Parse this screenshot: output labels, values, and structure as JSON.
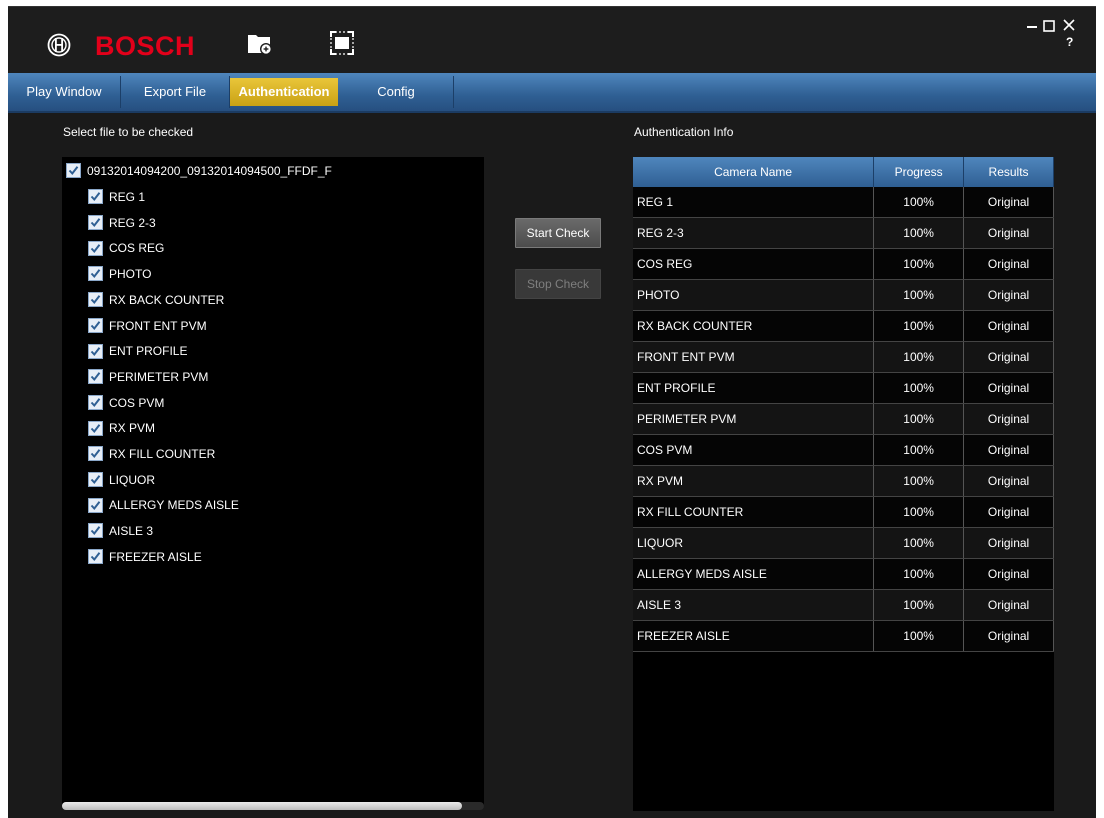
{
  "app": {
    "brand": "BOSCH",
    "brand_color": "#e2001a",
    "window_controls": {
      "minimize": "–",
      "maximize": "□",
      "close": "×",
      "help": "?"
    }
  },
  "menu": {
    "tabs": [
      {
        "label": "Play Window"
      },
      {
        "label": "Export File"
      },
      {
        "label": "Authentication",
        "active": true
      },
      {
        "label": "Config"
      }
    ]
  },
  "left": {
    "title": "Select file to be checked",
    "root": {
      "label": "09132014094200_09132014094500_FFDF_F",
      "checked": true
    },
    "items": [
      {
        "label": "REG 1",
        "checked": true
      },
      {
        "label": "REG 2-3",
        "checked": true
      },
      {
        "label": "COS REG",
        "checked": true
      },
      {
        "label": "PHOTO",
        "checked": true
      },
      {
        "label": "RX BACK COUNTER",
        "checked": true
      },
      {
        "label": "FRONT ENT PVM",
        "checked": true
      },
      {
        "label": "ENT PROFILE",
        "checked": true
      },
      {
        "label": "PERIMETER PVM",
        "checked": true
      },
      {
        "label": "COS PVM",
        "checked": true
      },
      {
        "label": "RX PVM",
        "checked": true
      },
      {
        "label": "RX FILL COUNTER",
        "checked": true
      },
      {
        "label": "LIQUOR",
        "checked": true
      },
      {
        "label": "ALLERGY MEDS AISLE",
        "checked": true
      },
      {
        "label": "AISLE 3",
        "checked": true
      },
      {
        "label": "FREEZER AISLE",
        "checked": true
      }
    ]
  },
  "buttons": {
    "start": "Start Check",
    "stop": "Stop Check"
  },
  "right": {
    "title": "Authentication Info",
    "columns": [
      "Camera Name",
      "Progress",
      "Results"
    ],
    "rows": [
      [
        "REG 1",
        "100%",
        "Original"
      ],
      [
        "REG 2-3",
        "100%",
        "Original"
      ],
      [
        "COS REG",
        "100%",
        "Original"
      ],
      [
        "PHOTO",
        "100%",
        "Original"
      ],
      [
        "RX BACK COUNTER",
        "100%",
        "Original"
      ],
      [
        "FRONT ENT PVM",
        "100%",
        "Original"
      ],
      [
        "ENT PROFILE",
        "100%",
        "Original"
      ],
      [
        "PERIMETER PVM",
        "100%",
        "Original"
      ],
      [
        "COS PVM",
        "100%",
        "Original"
      ],
      [
        "RX PVM",
        "100%",
        "Original"
      ],
      [
        "RX FILL COUNTER",
        "100%",
        "Original"
      ],
      [
        "LIQUOR",
        "100%",
        "Original"
      ],
      [
        "ALLERGY MEDS AISLE",
        "100%",
        "Original"
      ],
      [
        "AISLE 3",
        "100%",
        "Original"
      ],
      [
        "FREEZER AISLE",
        "100%",
        "Original"
      ]
    ]
  }
}
